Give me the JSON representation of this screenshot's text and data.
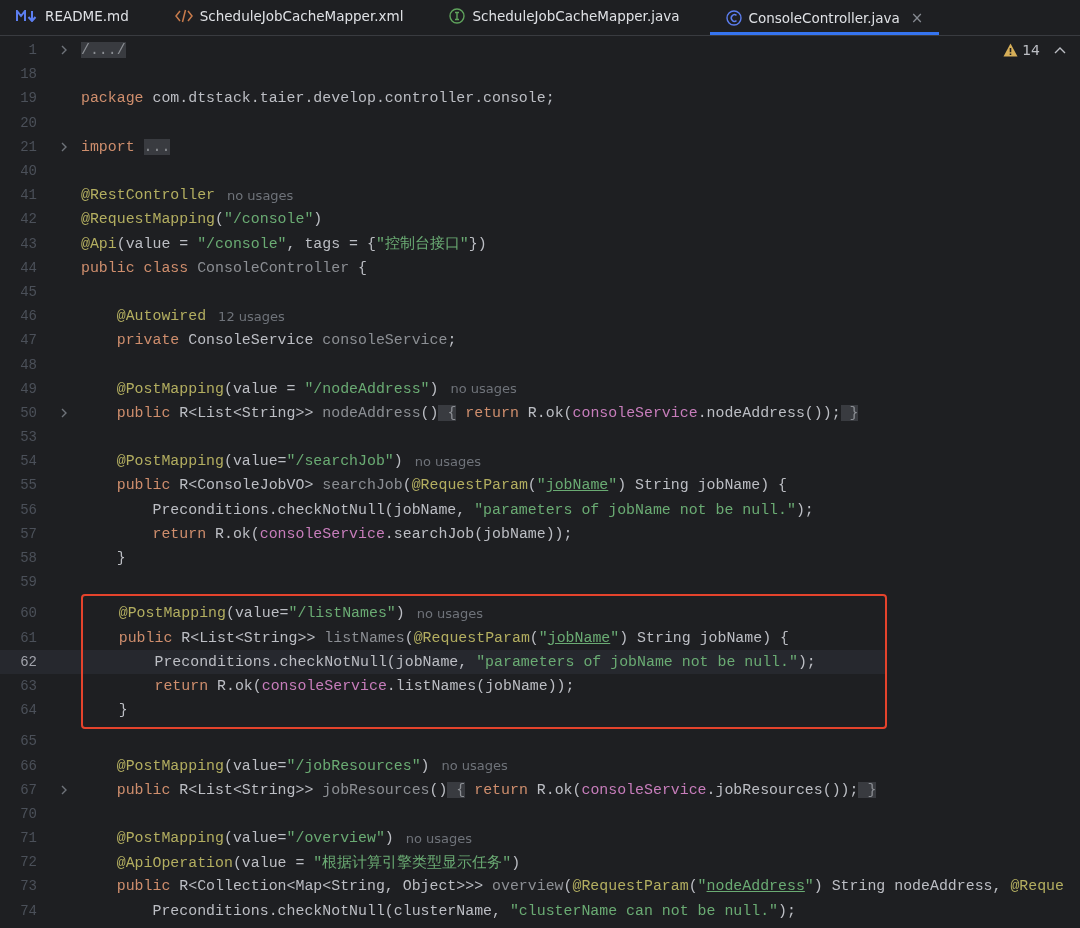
{
  "tabs": [
    {
      "label": "README.md",
      "kind": "markdown",
      "selected": false
    },
    {
      "label": "ScheduleJobCacheMapper.xml",
      "kind": "xml",
      "selected": false
    },
    {
      "label": "ScheduleJobCacheMapper.java",
      "kind": "interface",
      "selected": false
    },
    {
      "label": "ConsoleController.java",
      "kind": "class",
      "selected": true,
      "close": "×"
    }
  ],
  "inspections": {
    "warnings": "14"
  },
  "lines": [
    {
      "number": "1",
      "collapsed": true,
      "current": false,
      "boxed": false,
      "tokens": [
        {
          "kind": "fold",
          "text": "/.../"
        }
      ]
    },
    {
      "number": "18",
      "collapsed": false,
      "current": false,
      "boxed": false
    },
    {
      "number": "19",
      "collapsed": false,
      "current": false,
      "boxed": false,
      "tokens": [
        {
          "kind": "kw",
          "text": "package"
        },
        {
          "kind": "plain",
          "text": " com.dtstack.taier.develop.controller.console;"
        }
      ]
    },
    {
      "number": "20",
      "collapsed": false,
      "current": false,
      "boxed": false
    },
    {
      "number": "21",
      "collapsed": true,
      "current": false,
      "boxed": false,
      "tokens": [
        {
          "kind": "kw",
          "text": "import "
        },
        {
          "kind": "fold",
          "text": "..."
        }
      ]
    },
    {
      "number": "40",
      "collapsed": false,
      "current": false,
      "boxed": false
    },
    {
      "number": "41",
      "collapsed": false,
      "current": false,
      "boxed": false,
      "tokens": [
        {
          "kind": "ann",
          "text": "@RestController"
        }
      ],
      "hint": "no usages"
    },
    {
      "number": "42",
      "collapsed": false,
      "current": false,
      "boxed": false,
      "tokens": [
        {
          "kind": "ann",
          "text": "@RequestMapping"
        },
        {
          "kind": "plain",
          "text": "("
        },
        {
          "kind": "str",
          "text": "\"/console\""
        },
        {
          "kind": "plain",
          "text": ")"
        }
      ]
    },
    {
      "number": "43",
      "collapsed": false,
      "current": false,
      "boxed": false,
      "tokens": [
        {
          "kind": "ann",
          "text": "@Api"
        },
        {
          "kind": "plain",
          "text": "(value = "
        },
        {
          "kind": "str",
          "text": "\"/console\""
        },
        {
          "kind": "plain",
          "text": ", tags = {"
        },
        {
          "kind": "str",
          "text": "\"控制台接口\""
        },
        {
          "kind": "plain",
          "text": "})"
        }
      ]
    },
    {
      "number": "44",
      "collapsed": false,
      "current": false,
      "boxed": false,
      "tokens": [
        {
          "kind": "kw",
          "text": "public class "
        },
        {
          "kind": "unused",
          "text": "ConsoleController"
        },
        {
          "kind": "plain",
          "text": " {"
        }
      ]
    },
    {
      "number": "45",
      "collapsed": false,
      "current": false,
      "boxed": false
    },
    {
      "number": "46",
      "collapsed": false,
      "current": false,
      "boxed": false,
      "tokens": [
        {
          "kind": "ann",
          "text": "    @Autowired"
        }
      ],
      "hint": "12 usages"
    },
    {
      "number": "47",
      "collapsed": false,
      "current": false,
      "boxed": false,
      "tokens": [
        {
          "kind": "kw",
          "text": "    private "
        },
        {
          "kind": "plain",
          "text": "ConsoleService "
        },
        {
          "kind": "unused",
          "text": "consoleService"
        },
        {
          "kind": "plain",
          "text": ";"
        }
      ]
    },
    {
      "number": "48",
      "collapsed": false,
      "current": false,
      "boxed": false
    },
    {
      "number": "49",
      "collapsed": false,
      "current": false,
      "boxed": false,
      "tokens": [
        {
          "kind": "ann",
          "text": "    @PostMapping"
        },
        {
          "kind": "plain",
          "text": "(value = "
        },
        {
          "kind": "str",
          "text": "\"/nodeAddress\""
        },
        {
          "kind": "plain",
          "text": ")"
        }
      ],
      "hint": "no usages"
    },
    {
      "number": "50",
      "collapsed": true,
      "current": false,
      "boxed": false,
      "tokens": [
        {
          "kind": "kw",
          "text": "    public "
        },
        {
          "kind": "plain",
          "text": "R<List<String>> "
        },
        {
          "kind": "unused",
          "text": "nodeAddress"
        },
        {
          "kind": "plain",
          "text": "()"
        },
        {
          "kind": "fold",
          "text": " {"
        },
        {
          "kind": "kw",
          "text": " return"
        },
        {
          "kind": "plain",
          "text": " R.ok("
        },
        {
          "kind": "field",
          "text": "consoleService"
        },
        {
          "kind": "plain",
          "text": ".nodeAddress());"
        },
        {
          "kind": "fold",
          "text": " }"
        }
      ]
    },
    {
      "number": "53",
      "collapsed": false,
      "current": false,
      "boxed": false
    },
    {
      "number": "54",
      "collapsed": false,
      "current": false,
      "boxed": false,
      "tokens": [
        {
          "kind": "ann",
          "text": "    @PostMapping"
        },
        {
          "kind": "plain",
          "text": "(value="
        },
        {
          "kind": "str",
          "text": "\"/searchJob\""
        },
        {
          "kind": "plain",
          "text": ")"
        }
      ],
      "hint": "no usages"
    },
    {
      "number": "55",
      "collapsed": false,
      "current": false,
      "boxed": false,
      "tokens": [
        {
          "kind": "kw",
          "text": "    public "
        },
        {
          "kind": "plain",
          "text": "R<ConsoleJobVO> "
        },
        {
          "kind": "unused",
          "text": "searchJob"
        },
        {
          "kind": "plain",
          "text": "("
        },
        {
          "kind": "ann",
          "text": "@RequestParam"
        },
        {
          "kind": "plain",
          "text": "("
        },
        {
          "kind": "str",
          "text": "\""
        },
        {
          "kind": "link",
          "text": "jobName"
        },
        {
          "kind": "str",
          "text": "\""
        },
        {
          "kind": "plain",
          "text": ") String jobName) {"
        }
      ]
    },
    {
      "number": "56",
      "collapsed": false,
      "current": false,
      "boxed": false,
      "tokens": [
        {
          "kind": "plain",
          "text": "        Preconditions.checkNotNull(jobName, "
        },
        {
          "kind": "str",
          "text": "\"parameters of jobName not be null.\""
        },
        {
          "kind": "plain",
          "text": ");"
        }
      ]
    },
    {
      "number": "57",
      "collapsed": false,
      "current": false,
      "boxed": false,
      "tokens": [
        {
          "kind": "kw",
          "text": "        return"
        },
        {
          "kind": "plain",
          "text": " R.ok("
        },
        {
          "kind": "field",
          "text": "consoleService"
        },
        {
          "kind": "plain",
          "text": ".searchJob(jobName));"
        }
      ]
    },
    {
      "number": "58",
      "collapsed": false,
      "current": false,
      "boxed": false,
      "tokens": [
        {
          "kind": "plain",
          "text": "    }"
        }
      ]
    },
    {
      "number": "59",
      "collapsed": false,
      "current": false,
      "boxed": false
    },
    {
      "number": "60",
      "collapsed": false,
      "current": false,
      "boxed": true,
      "tokens": [
        {
          "kind": "ann",
          "text": "    @PostMapping"
        },
        {
          "kind": "plain",
          "text": "(value="
        },
        {
          "kind": "str",
          "text": "\"/listNames\""
        },
        {
          "kind": "plain",
          "text": ")"
        }
      ],
      "hint": "no usages"
    },
    {
      "number": "61",
      "collapsed": false,
      "current": false,
      "boxed": true,
      "tokens": [
        {
          "kind": "kw",
          "text": "    public "
        },
        {
          "kind": "plain",
          "text": "R<List<String>> "
        },
        {
          "kind": "unused",
          "text": "listNames"
        },
        {
          "kind": "plain",
          "text": "("
        },
        {
          "kind": "ann",
          "text": "@RequestParam"
        },
        {
          "kind": "plain",
          "text": "("
        },
        {
          "kind": "str",
          "text": "\""
        },
        {
          "kind": "link",
          "text": "jobName"
        },
        {
          "kind": "str",
          "text": "\""
        },
        {
          "kind": "plain",
          "text": ") String jobName) {"
        }
      ]
    },
    {
      "number": "62",
      "collapsed": false,
      "current": true,
      "boxed": true,
      "tokens": [
        {
          "kind": "plain",
          "text": "        Preconditions.checkNotNull(jobName, "
        },
        {
          "kind": "str",
          "text": "\"parameters of jobName not be null.\""
        },
        {
          "kind": "plain",
          "text": ");"
        }
      ]
    },
    {
      "number": "63",
      "collapsed": false,
      "current": false,
      "boxed": true,
      "tokens": [
        {
          "kind": "kw",
          "text": "        return"
        },
        {
          "kind": "plain",
          "text": " R.ok("
        },
        {
          "kind": "field",
          "text": "consoleService"
        },
        {
          "kind": "plain",
          "text": ".listNames(jobName));"
        }
      ]
    },
    {
      "number": "64",
      "collapsed": false,
      "current": false,
      "boxed": true,
      "tokens": [
        {
          "kind": "plain",
          "text": "    }"
        }
      ]
    },
    {
      "number": "65",
      "collapsed": false,
      "current": false,
      "boxed": false
    },
    {
      "number": "66",
      "collapsed": false,
      "current": false,
      "boxed": false,
      "tokens": [
        {
          "kind": "ann",
          "text": "    @PostMapping"
        },
        {
          "kind": "plain",
          "text": "(value="
        },
        {
          "kind": "str",
          "text": "\"/jobResources\""
        },
        {
          "kind": "plain",
          "text": ")"
        }
      ],
      "hint": "no usages"
    },
    {
      "number": "67",
      "collapsed": true,
      "current": false,
      "boxed": false,
      "tokens": [
        {
          "kind": "kw",
          "text": "    public "
        },
        {
          "kind": "plain",
          "text": "R<List<String>> "
        },
        {
          "kind": "unused",
          "text": "jobResources"
        },
        {
          "kind": "plain",
          "text": "()"
        },
        {
          "kind": "fold",
          "text": " {"
        },
        {
          "kind": "kw",
          "text": " return"
        },
        {
          "kind": "plain",
          "text": " R.ok("
        },
        {
          "kind": "field",
          "text": "consoleService"
        },
        {
          "kind": "plain",
          "text": ".jobResources());"
        },
        {
          "kind": "fold",
          "text": " }"
        }
      ]
    },
    {
      "number": "70",
      "collapsed": false,
      "current": false,
      "boxed": false
    },
    {
      "number": "71",
      "collapsed": false,
      "current": false,
      "boxed": false,
      "tokens": [
        {
          "kind": "ann",
          "text": "    @PostMapping"
        },
        {
          "kind": "plain",
          "text": "(value="
        },
        {
          "kind": "str",
          "text": "\"/overview\""
        },
        {
          "kind": "plain",
          "text": ")"
        }
      ],
      "hint": "no usages"
    },
    {
      "number": "72",
      "collapsed": false,
      "current": false,
      "boxed": false,
      "tokens": [
        {
          "kind": "ann",
          "text": "    @ApiOperation"
        },
        {
          "kind": "plain",
          "text": "(value = "
        },
        {
          "kind": "str",
          "text": "\"根据计算引擎类型显示任务\""
        },
        {
          "kind": "plain",
          "text": ")"
        }
      ]
    },
    {
      "number": "73",
      "collapsed": false,
      "current": false,
      "boxed": false,
      "tokens": [
        {
          "kind": "kw",
          "text": "    public "
        },
        {
          "kind": "plain",
          "text": "R<Collection<Map<String, Object>>> "
        },
        {
          "kind": "unused",
          "text": "overview"
        },
        {
          "kind": "plain",
          "text": "("
        },
        {
          "kind": "ann",
          "text": "@RequestParam"
        },
        {
          "kind": "plain",
          "text": "("
        },
        {
          "kind": "str",
          "text": "\""
        },
        {
          "kind": "link",
          "text": "nodeAddress"
        },
        {
          "kind": "str",
          "text": "\""
        },
        {
          "kind": "plain",
          "text": ") String nodeAddress, "
        },
        {
          "kind": "ann",
          "text": "@Reque"
        }
      ]
    },
    {
      "number": "74",
      "collapsed": false,
      "current": false,
      "boxed": false,
      "tokens": [
        {
          "kind": "plain",
          "text": "        Preconditions.checkNotNull(clusterName, "
        },
        {
          "kind": "str",
          "text": "\"clusterName can not be null.\""
        },
        {
          "kind": "plain",
          "text": ");"
        }
      ]
    }
  ]
}
